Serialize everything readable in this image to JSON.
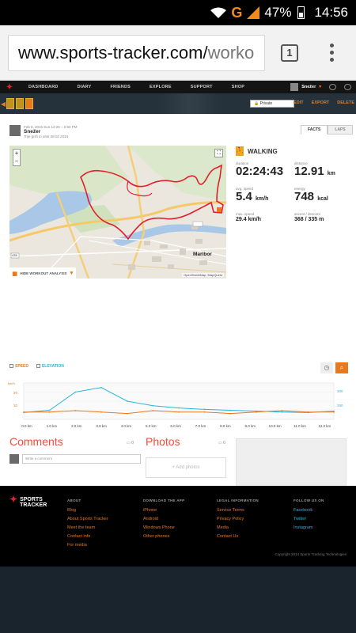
{
  "status_bar": {
    "network": "G",
    "battery": "47%",
    "time": "14:56"
  },
  "browser": {
    "url_main": "www.sports-tracker.com/",
    "url_rest": "worko",
    "tab_count": "1"
  },
  "nav": {
    "items": [
      "DASHBOARD",
      "DIARY",
      "FRIENDS",
      "EXPLORE",
      "SUPPORT",
      "SHOP"
    ],
    "user": "Snežer"
  },
  "toolbar": {
    "privacy": "Private",
    "edit": "EDIT",
    "export": "EXPORT",
    "delete": "DELETE"
  },
  "workout": {
    "date": "Feb 8, 2015 Sun 12:25 – 2:50 PM",
    "user": "Snežer",
    "description": "Trije griči in otok 08.02.2015"
  },
  "tabs": {
    "facts": "FACTS",
    "laps": "LAPS"
  },
  "map": {
    "analysis_label": "HIDE WORKOUT ANALYSIS",
    "credit": "OpenStreetMap, MapQuest",
    "city": "Maribor",
    "road": "435"
  },
  "facts": {
    "activity": "WALKING",
    "duration_label": "duration",
    "duration": "02:24:43",
    "distance_label": "distance",
    "distance": "12.91",
    "distance_unit": "km",
    "speed_label": "avg. speed",
    "speed": "5.4",
    "speed_unit": "km/h",
    "energy_label": "energy",
    "energy": "748",
    "energy_unit": "kcal",
    "maxspeed_label": "max. speed",
    "maxspeed": "29.4",
    "maxspeed_unit": "km/h",
    "ascent_label": "ascent / descent",
    "ascent": "368 / 335 m"
  },
  "chart_legend": {
    "speed": "SPEED",
    "elevation": "ELEVATION"
  },
  "chart_data": {
    "type": "line",
    "x_unit": "km",
    "xlabel": "",
    "ylabel": "",
    "x_ticks": [
      "0.0 km",
      "1.0 km",
      "2.0 km",
      "3.0 km",
      "4.0 km",
      "5.0 km",
      "6.0 km",
      "7.0 km",
      "8.0 km",
      "9.0 km",
      "10.0 km",
      "11.0 km",
      "12.0 km"
    ],
    "left_ticks": [
      "20",
      "10"
    ],
    "left_unit": "km/h",
    "right_ticks": [
      "300",
      "250"
    ],
    "speed": [
      5,
      5,
      6,
      5,
      4,
      6,
      5,
      5,
      4,
      5,
      6,
      5,
      5
    ],
    "elevation": [
      255,
      260,
      300,
      310,
      280,
      270,
      265,
      262,
      260,
      258,
      256,
      255,
      258
    ]
  },
  "comments": {
    "title": "Comments",
    "count": "0",
    "placeholder": "Write a comment"
  },
  "photos": {
    "title": "Photos",
    "count": "0",
    "add_label": "+ Add photos"
  },
  "footer": {
    "logo": [
      "SPORTS",
      "TRACKER"
    ],
    "about": {
      "title": "ABOUT",
      "links": [
        "Blog",
        "About Sports Tracker",
        "Meet the team",
        "Contact info",
        "For media"
      ]
    },
    "download": {
      "title": "DOWNLOAD THE APP",
      "links": [
        "iPhone",
        "Android",
        "Windows Phone",
        "Other phones"
      ]
    },
    "legal": {
      "title": "LEGAL INFORMATION",
      "links": [
        "Service Terms",
        "Privacy Policy",
        "Media",
        "Contact Us"
      ]
    },
    "follow": {
      "title": "FOLLOW US ON",
      "links": [
        "Facebook",
        "Twitter",
        "Instagram"
      ]
    },
    "copyright": "Copyright 2014 Sports Tracking Technologies"
  }
}
